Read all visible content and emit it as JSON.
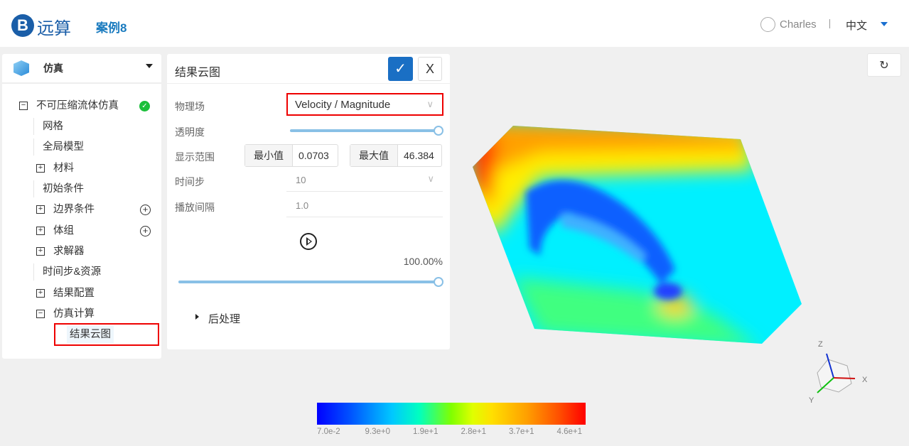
{
  "header": {
    "logo_letter": "B",
    "brand": "远算",
    "case_name": "案例8",
    "user": "Charles",
    "language": "中文"
  },
  "sidebar": {
    "title": "仿真",
    "items": [
      {
        "label": "不可压缩流体仿真",
        "toggle": "−",
        "status": "ok"
      },
      {
        "label": "网格"
      },
      {
        "label": "全局模型"
      },
      {
        "label": "材料",
        "toggle": "+"
      },
      {
        "label": "初始条件"
      },
      {
        "label": "边界条件",
        "toggle": "+",
        "add": true
      },
      {
        "label": "体组",
        "toggle": "+",
        "add": true
      },
      {
        "label": "求解器",
        "toggle": "+"
      },
      {
        "label": "时间步&资源"
      },
      {
        "label": "结果配置",
        "toggle": "+"
      },
      {
        "label": "仿真计算",
        "toggle": "−"
      },
      {
        "label": "结果云图",
        "selected": true
      }
    ]
  },
  "panel": {
    "title": "结果云图",
    "confirm": "✓",
    "close": "X",
    "field_label": "物理场",
    "field_value": "Velocity / Magnitude",
    "opacity_label": "透明度",
    "opacity": 1.0,
    "range_label": "显示范围",
    "min_label": "最小值",
    "min_value": "0.0703",
    "max_label": "最大值",
    "max_value": "46.384",
    "timestep_label": "时间步",
    "timestep_value": "10",
    "interval_label": "播放间隔",
    "interval_value": "1.0",
    "progress_text": "100.00%",
    "progress": 1.0,
    "post_label": "后处理"
  },
  "colorbar": {
    "ticks": [
      "7.0e-2",
      "9.3e+0",
      "1.9e+1",
      "2.8e+1",
      "3.7e+1",
      "4.6e+1"
    ],
    "colors": [
      "#0000ff",
      "#00ffff",
      "#80ff00",
      "#ffff00",
      "#ff0000"
    ]
  },
  "axes": {
    "x": "X",
    "y": "Y",
    "z": "Z"
  }
}
